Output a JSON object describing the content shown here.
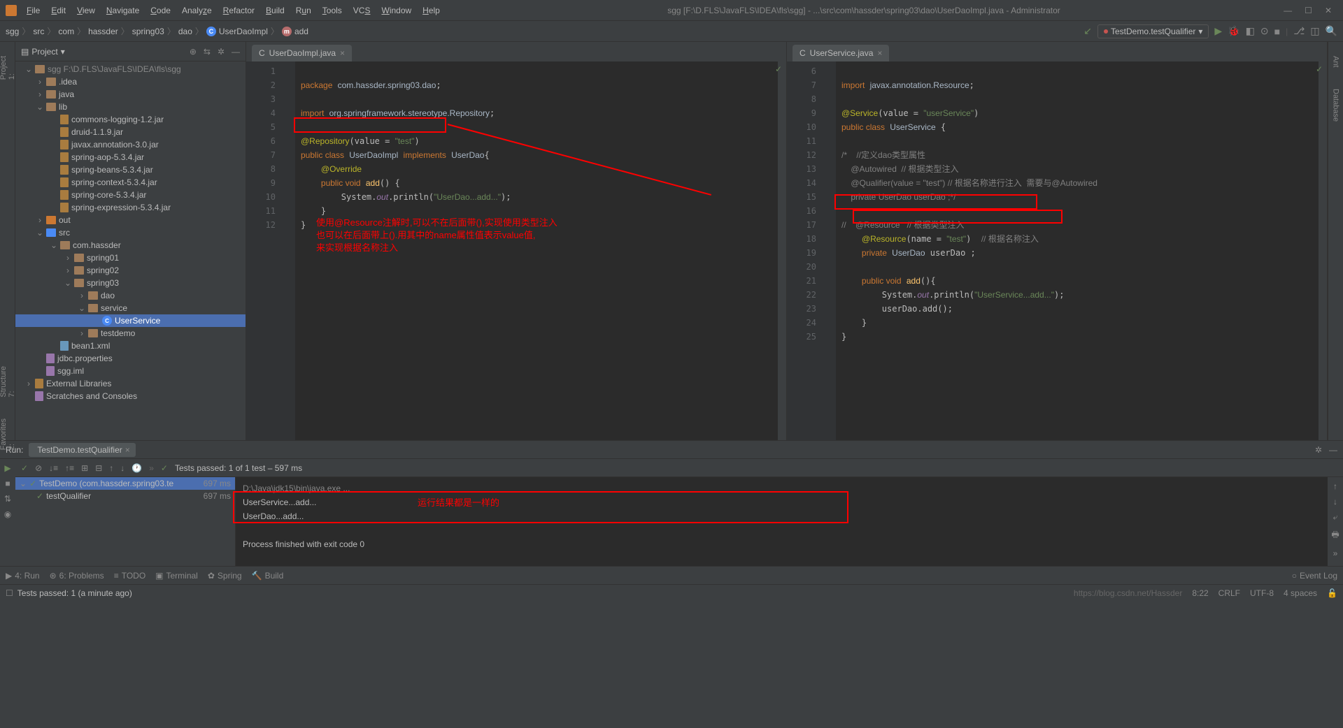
{
  "window": {
    "title": "sgg [F:\\D.FLS\\JavaFLS\\IDEA\\fls\\sgg] - ...\\src\\com\\hassder\\spring03\\dao\\UserDaoImpl.java - Administrator"
  },
  "menu": [
    "File",
    "Edit",
    "View",
    "Navigate",
    "Code",
    "Analyze",
    "Refactor",
    "Build",
    "Run",
    "Tools",
    "VCS",
    "Window",
    "Help"
  ],
  "breadcrumb": [
    "sgg",
    "src",
    "com",
    "hassder",
    "spring03",
    "dao",
    "UserDaoImpl",
    "add"
  ],
  "run_config": "TestDemo.testQualifier",
  "project": {
    "title": "Project",
    "root": "sgg F:\\D.FLS\\JavaFLS\\IDEA\\fls\\sgg",
    "items": [
      {
        "pad": 30,
        "label": ".idea",
        "arrow": "›",
        "icon": "folder"
      },
      {
        "pad": 30,
        "label": "java",
        "arrow": "›",
        "icon": "folder"
      },
      {
        "pad": 30,
        "label": "lib",
        "arrow": "⌄",
        "icon": "folder"
      },
      {
        "pad": 50,
        "label": "commons-logging-1.2.jar",
        "icon": "lib"
      },
      {
        "pad": 50,
        "label": "druid-1.1.9.jar",
        "icon": "lib"
      },
      {
        "pad": 50,
        "label": "javax.annotation-3.0.jar",
        "icon": "lib"
      },
      {
        "pad": 50,
        "label": "spring-aop-5.3.4.jar",
        "icon": "lib"
      },
      {
        "pad": 50,
        "label": "spring-beans-5.3.4.jar",
        "icon": "lib"
      },
      {
        "pad": 50,
        "label": "spring-context-5.3.4.jar",
        "icon": "lib"
      },
      {
        "pad": 50,
        "label": "spring-core-5.3.4.jar",
        "icon": "lib"
      },
      {
        "pad": 50,
        "label": "spring-expression-5.3.4.jar",
        "icon": "lib"
      },
      {
        "pad": 30,
        "label": "out",
        "arrow": "›",
        "icon": "folder-orange"
      },
      {
        "pad": 30,
        "label": "src",
        "arrow": "⌄",
        "icon": "folder-blue"
      },
      {
        "pad": 50,
        "label": "com.hassder",
        "arrow": "⌄",
        "icon": "folder"
      },
      {
        "pad": 70,
        "label": "spring01",
        "arrow": "›",
        "icon": "folder"
      },
      {
        "pad": 70,
        "label": "spring02",
        "arrow": "›",
        "icon": "folder"
      },
      {
        "pad": 70,
        "label": "spring03",
        "arrow": "⌄",
        "icon": "folder"
      },
      {
        "pad": 90,
        "label": "dao",
        "arrow": "›",
        "icon": "folder"
      },
      {
        "pad": 90,
        "label": "service",
        "arrow": "⌄",
        "icon": "folder"
      },
      {
        "pad": 110,
        "label": "UserService",
        "icon": "class",
        "selected": true
      },
      {
        "pad": 90,
        "label": "testdemo",
        "arrow": "›",
        "icon": "folder"
      },
      {
        "pad": 50,
        "label": "bean1.xml",
        "icon": "xml"
      },
      {
        "pad": 30,
        "label": "jdbc.properties",
        "icon": "file"
      },
      {
        "pad": 30,
        "label": "sgg.iml",
        "icon": "file"
      },
      {
        "pad": 14,
        "label": "External Libraries",
        "arrow": "›",
        "icon": "lib"
      },
      {
        "pad": 14,
        "label": "Scratches and Consoles",
        "icon": "file"
      }
    ]
  },
  "editor1": {
    "tab": "UserDaoImpl.java",
    "lines": [
      "1",
      "2",
      "3",
      "4",
      "5",
      "6",
      "7",
      "8",
      "9",
      "10",
      "11",
      "12"
    ],
    "code": {
      "l1": "package com.hassder.spring03.dao;",
      "l3": "import org.springframework.stereotype.Repository;",
      "l5": "@Repository(value = \"test\")",
      "l6": "public class UserDaoImpl implements UserDao{",
      "l7": "    @Override",
      "l8": "    public void add() {",
      "l9": "        System.out.println(\"UserDao...add...\");",
      "l10": "    }",
      "l11": "}"
    },
    "annotation": "使用@Resource注解时,可以不在后面带(),实现使用类型注入\n也可以在后面带上().用其中的name属性值表示value值,\n来实现根据名称注入"
  },
  "editor2": {
    "tab": "UserService.java",
    "lines": [
      "6",
      "7",
      "8",
      "9",
      "10",
      "11",
      "12",
      "13",
      "14",
      "15",
      "16",
      "17",
      "18",
      "19",
      "20",
      "21",
      "22",
      "23",
      "24",
      "25"
    ],
    "code": {
      "l6": "import javax.annotation.Resource;",
      "l8": "@Service(value = \"userService\")",
      "l9": "public class UserService {",
      "l11": "/*    //定义dao类型属性",
      "l12": "    @Autowired  // 根据类型注入",
      "l13": "    @Qualifier(value = \"test\") // 根据名称进行注入  需要与@Autowired",
      "l14": "    private UserDao userDao ;*/",
      "l16": "//    @Resource   // 根据类型注入",
      "l17": "    @Resource(name = \"test\")  // 根据名称注入",
      "l18": "    private UserDao userDao ;",
      "l20": "    public void add(){",
      "l21": "        System.out.println(\"UserService...add...\");",
      "l22": "        userDao.add();",
      "l23": "    }",
      "l24": "}"
    }
  },
  "run": {
    "title": "Run:",
    "tab": "TestDemo.testQualifier",
    "toolbar_text": "Tests passed: 1 of 1 test – 597 ms",
    "test1": "TestDemo (com.hassder.spring03.te",
    "test1_time": "697 ms",
    "test2": "testQualifier",
    "test2_time": "697 ms",
    "console_cmd": "D:\\Java\\jdk15\\bin\\java.exe ...",
    "console_l1": "UserService...add...",
    "console_l2": "UserDao...add...",
    "console_exit": "Process finished with exit code 0",
    "annotation": "运行结果都是一样的"
  },
  "bottom": {
    "run": "4: Run",
    "problems": "6: Problems",
    "todo": "TODO",
    "terminal": "Terminal",
    "spring": "Spring",
    "build": "Build",
    "event_log": "Event Log"
  },
  "status": {
    "text": "Tests passed: 1 (a minute ago)",
    "pos": "8:22",
    "crlf": "CRLF",
    "encoding": "UTF-8",
    "indent": "4 spaces",
    "watermark": "https://blog.csdn.net/Hassder"
  }
}
